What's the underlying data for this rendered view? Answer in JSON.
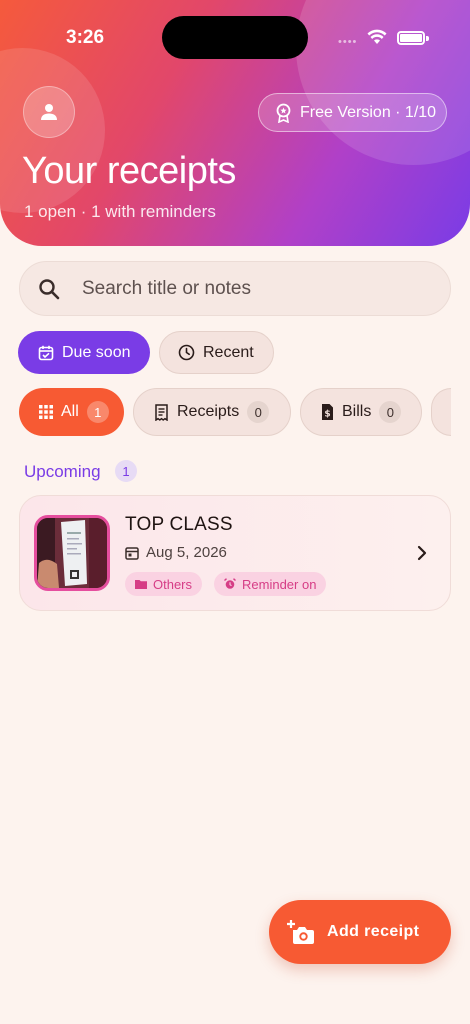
{
  "status_bar": {
    "time": "3:26",
    "signal": "••••"
  },
  "header": {
    "plan_badge": "Free Version · 1/10",
    "title": "Your receipts",
    "subtitle": "1 open · 1 with reminders"
  },
  "search": {
    "placeholder": "Search title or notes"
  },
  "sort_chips": [
    {
      "label": "Due soon",
      "selected": true
    },
    {
      "label": "Recent",
      "selected": false
    }
  ],
  "category_chips": [
    {
      "label": "All",
      "count": "1",
      "selected": true
    },
    {
      "label": "Receipts",
      "count": "0",
      "selected": false
    },
    {
      "label": "Bills",
      "count": "0",
      "selected": false
    }
  ],
  "section": {
    "label": "Upcoming",
    "count": "1"
  },
  "receipt": {
    "title": "TOP CLASS",
    "date": "Aug 5, 2026",
    "category": "Others",
    "reminder": "Reminder on"
  },
  "fab": {
    "label": "Add receipt"
  },
  "colors": {
    "accent_orange": "#f75a33",
    "accent_purple": "#7a3ce6",
    "tag_pink": "#d63d86",
    "background": "#fdf3ee"
  }
}
